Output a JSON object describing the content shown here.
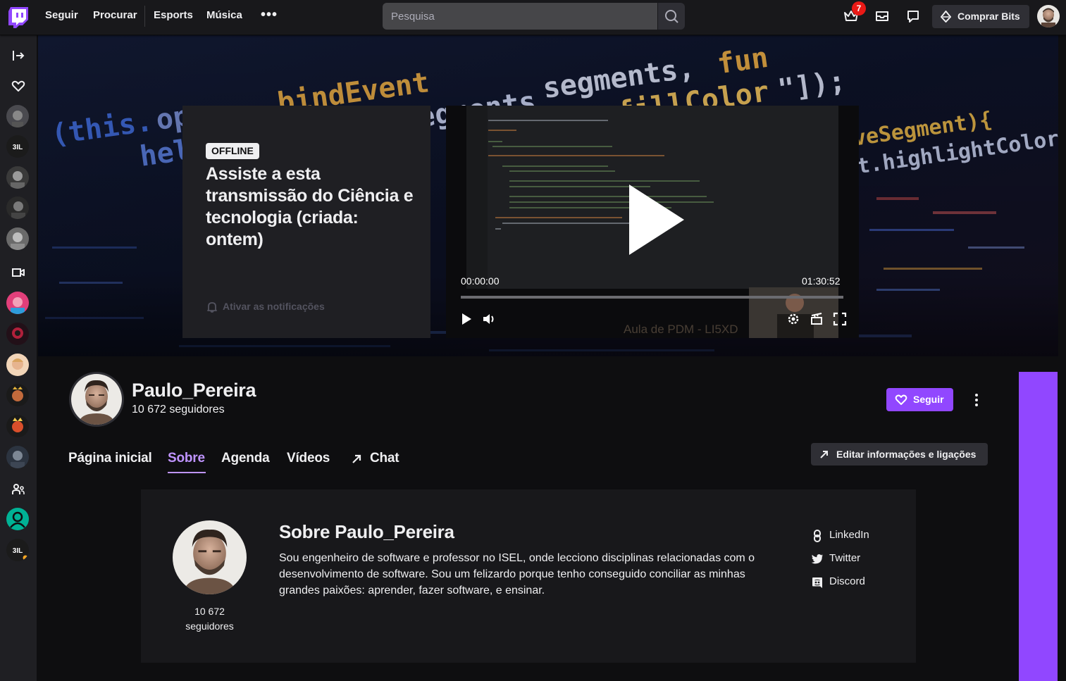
{
  "nav": {
    "links": [
      "Seguir",
      "Procurar",
      "Esports",
      "Música"
    ],
    "more_icon": "more-horizontal-icon",
    "search_placeholder": "Pesquisa",
    "notification_count": "7",
    "bits_label": "Comprar Bits"
  },
  "banner": {
    "offline_badge": "OFFLINE",
    "title": "Assiste a esta transmissão do Ciência e tecnologia (criada: ontem)",
    "notify_label": "Ativar as notificações",
    "player": {
      "time_current": "00:00:00",
      "time_total": "01:30:52",
      "progress": 0,
      "watermark": "Aula de PDM - LI5XD"
    }
  },
  "channel": {
    "name": "Paulo_Pereira",
    "followers": "10 672 seguidores",
    "follow_label": "Seguir",
    "tabs": [
      "Página inicial",
      "Sobre",
      "Agenda",
      "Vídeos",
      "Chat"
    ],
    "active_tab": "Sobre",
    "edit_label": "Editar informações e ligações"
  },
  "about": {
    "count": "10 672",
    "count_label": "seguidores",
    "title": "Sobre Paulo_Pereira",
    "bio": "Sou engenheiro de software e professor no ISEL, onde lecciono disciplinas relacionadas com o desenvolvimento de software. Sou um felizardo porque tenho conseguido conciliar as minhas grandes paixões: aprender, fazer software, e ensinar.",
    "links": [
      {
        "label": "LinkedIn",
        "icon": "link-icon"
      },
      {
        "label": "Twitter",
        "icon": "twitter-icon"
      },
      {
        "label": "Discord",
        "icon": "discord-icon"
      }
    ]
  },
  "colors": {
    "accent": "#9147ff",
    "accent_light": "#bf94ff",
    "background": "#0e0e10",
    "surface": "#18181b",
    "badge": "#e91916"
  }
}
